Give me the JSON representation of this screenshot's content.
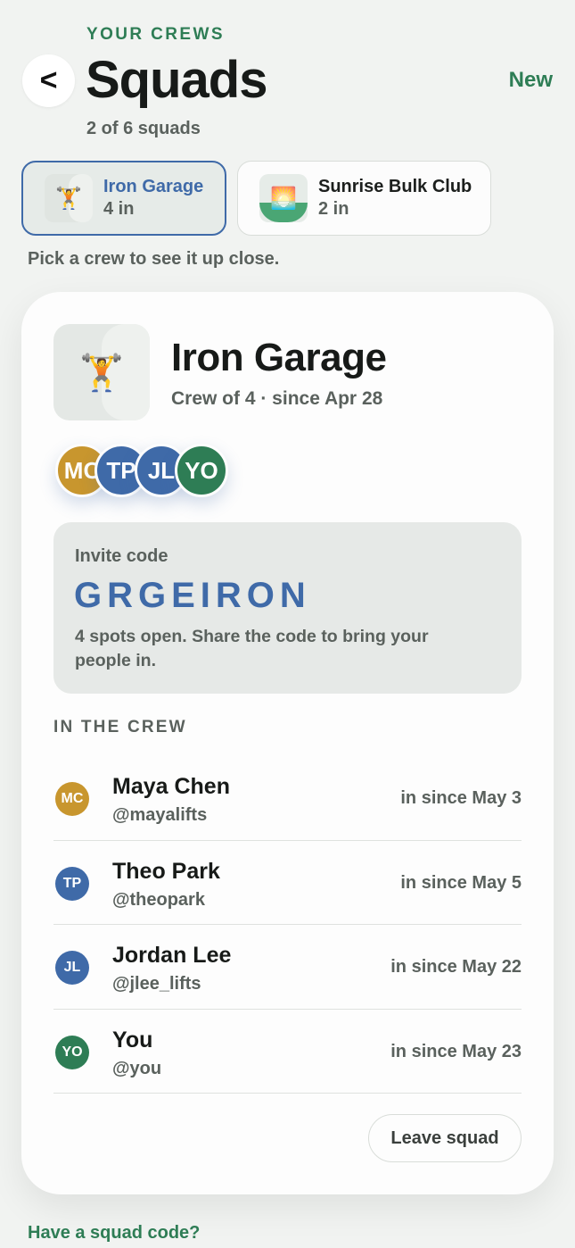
{
  "header": {
    "eyebrow": "YOUR CREWS",
    "back_label": "<",
    "title": "Squads",
    "new_label": "New",
    "count_text": "2 of 6 squads"
  },
  "squad_tabs": [
    {
      "name": "Iron Garage",
      "members": "4 in",
      "icon": "weightlifter-icon",
      "emoji": "🏋️"
    },
    {
      "name": "Sunrise Bulk Club",
      "members": "2 in",
      "icon": "sunrise-icon",
      "emoji": "🌅"
    }
  ],
  "hint": "Pick a crew to see it up close.",
  "crew": {
    "name": "Iron Garage",
    "emoji": "🏋️",
    "meta": "Crew of 4 · since Apr 28",
    "avatar_stack": [
      {
        "initials": "MC",
        "color": "#c8962e"
      },
      {
        "initials": "TP",
        "color": "#3f6aa8"
      },
      {
        "initials": "JL",
        "color": "#3f6aa8"
      },
      {
        "initials": "YO",
        "color": "#2e7d55"
      }
    ],
    "invite": {
      "label": "Invite code",
      "code": "GRGEIRON",
      "note": "4 spots open. Share the code to bring your people in."
    },
    "section_title": "IN THE CREW",
    "members": [
      {
        "initials": "MC",
        "name": "Maya Chen",
        "handle": "@mayalifts",
        "since": "in since May 3",
        "color": "#c8962e"
      },
      {
        "initials": "TP",
        "name": "Theo Park",
        "handle": "@theopark",
        "since": "in since May 5",
        "color": "#3f6aa8"
      },
      {
        "initials": "JL",
        "name": "Jordan Lee",
        "handle": "@jlee_lifts",
        "since": "in since May 22",
        "color": "#3f6aa8"
      },
      {
        "initials": "YO",
        "name": "You",
        "handle": "@you",
        "since": "in since May 23",
        "color": "#2e7d55"
      }
    ],
    "leave_label": "Leave squad"
  },
  "footer_link": "Have a squad code?",
  "colors": {
    "accent_green": "#2e7d55",
    "accent_blue": "#3f6aa8",
    "background": "#f1f3f1"
  }
}
